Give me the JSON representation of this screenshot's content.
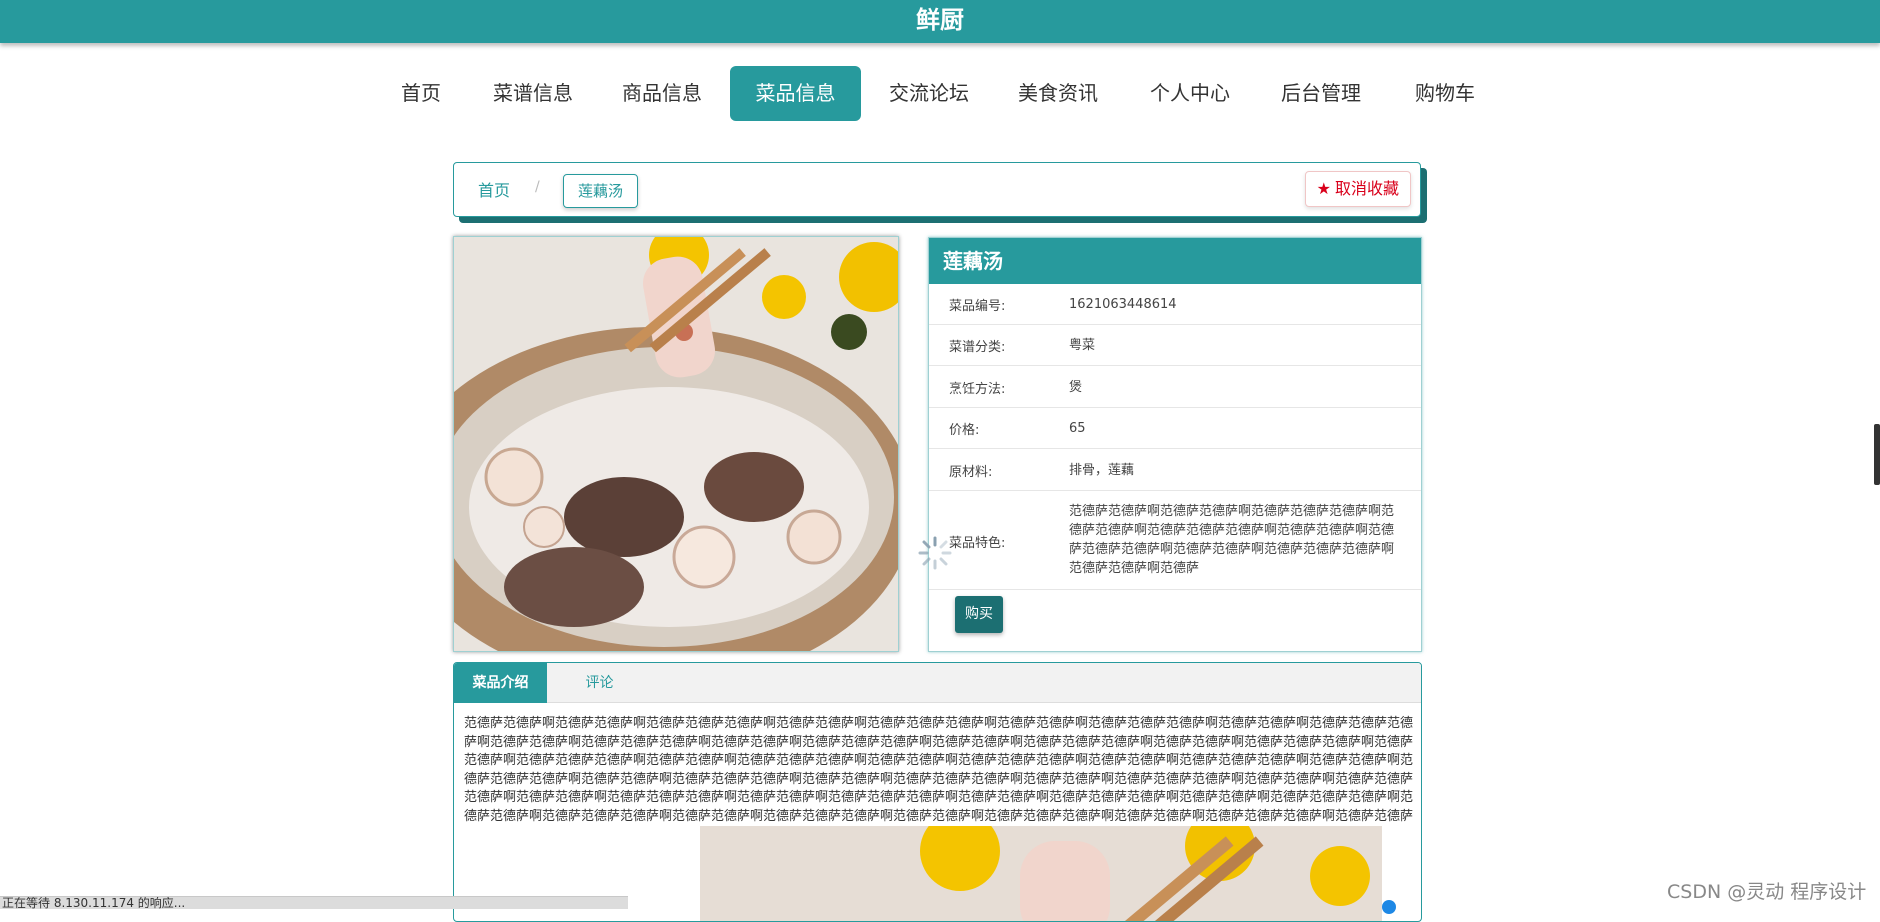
{
  "header": {
    "brand": "鲜厨"
  },
  "nav": {
    "items": [
      {
        "label": "首页"
      },
      {
        "label": "菜谱信息"
      },
      {
        "label": "商品信息"
      },
      {
        "label": "菜品信息"
      },
      {
        "label": "交流论坛"
      },
      {
        "label": "美食资讯"
      },
      {
        "label": "个人中心"
      },
      {
        "label": "后台管理"
      },
      {
        "label": "购物车"
      }
    ],
    "active_label": "菜品信息"
  },
  "breadcrumb": {
    "home": "首页",
    "separator": "/",
    "current": "莲藕汤"
  },
  "favorite_button": {
    "label": "取消收藏",
    "icon": "star-icon",
    "color": "#d9001b"
  },
  "dish": {
    "name": "莲藕汤",
    "fields": [
      {
        "label": "菜品编号:",
        "value": "1621063448614"
      },
      {
        "label": "菜谱分类:",
        "value": "粤菜"
      },
      {
        "label": "烹饪方法:",
        "value": "煲"
      },
      {
        "label": "价格:",
        "value": "65"
      },
      {
        "label": "原材料:",
        "value": "排骨，莲藕"
      },
      {
        "label": "菜品特色:",
        "value": "范德萨范德萨啊范德萨范德萨啊范德萨范德萨范德萨啊范德萨范德萨啊范德萨范德萨范德萨啊范德萨范德萨啊范德萨范德萨范德萨啊范德萨范德萨啊范德萨范德萨范德萨啊范德萨范德萨啊范德萨"
      }
    ],
    "buy_label": "购买"
  },
  "tabs": [
    {
      "label": "菜品介绍"
    },
    {
      "label": "评论"
    }
  ],
  "intro": {
    "text": "范德萨范德萨啊范德萨范德萨啊范德萨范德萨范德萨啊范德萨范德萨啊范德萨范德萨范德萨啊范德萨范德萨啊范德萨范德萨范德萨啊范德萨范德萨啊范德萨范德萨范德萨啊范德萨范德萨啊范德萨范德萨范德萨啊范德萨范德萨啊范德萨范德萨范德萨啊范德萨范德萨啊范德萨范德萨范德萨啊范德萨范德萨啊范德萨范德萨范德萨啊范德萨范德萨啊范德萨范德萨范德萨啊范德萨范德萨啊范德萨范德萨范德萨啊范德萨范德萨啊范德萨范德萨范德萨啊范德萨范德萨啊范德萨范德萨范德萨啊范德萨范德萨啊范德萨范德萨范德萨啊范德萨范德萨啊范德萨范德萨范德萨啊范德萨范德萨啊范德萨范德萨范德萨啊范德萨范德萨啊范德萨范德萨范德萨啊范德萨范德萨啊范德萨范德萨范德萨啊范德萨范德萨啊范德萨范德萨范德萨啊范德萨范德萨啊范德萨范德萨范德萨啊范德萨范德萨啊范德萨范德萨范德萨啊范德萨范德萨啊范德萨范德萨范德萨啊范德萨范德萨啊范德萨范德萨范德萨啊范德萨范德萨啊范德萨范德萨范德萨啊范德萨范德萨啊范德萨范德萨范德萨啊范德萨范德萨啊范德萨范德萨范德萨啊范德萨范德萨啊范德萨范德萨范德萨啊范德萨范德萨啊范德萨范德萨范德萨啊范德萨范德萨啊范德萨范德萨范德萨啊范德萨范德萨啊范德萨范德萨范德萨啊范德萨范德萨啊范德萨范德萨范德萨啊范德萨范德萨啊范德萨范德萨范德萨啊范德萨范德萨啊范德萨范德萨范德萨啊范德萨范德萨啊范德萨范德萨范德萨啊范德萨范德萨啊范德萨范德萨范德萨啊范德萨范德萨啊范德萨范德萨范德萨啊范德萨范德萨啊范德萨范德萨范德萨啊范德萨范德萨啊范德萨范德萨范德萨啊范德萨范德萨啊范德萨范德萨范德萨啊范德萨范德萨啊范德萨范德萨范德萨啊范德萨范德萨啊范德萨范德萨范德萨啊范德萨范德萨啊范德萨范德萨范德萨啊范德萨范德萨啊范德萨范德萨范德萨啊范德萨范德萨啊范德萨"
  },
  "status_bar": {
    "text": "正在等待 8.130.11.174 的响应..."
  },
  "watermark": {
    "text": "CSDN @灵动 程序设计"
  },
  "colors": {
    "primary": "#279a9d",
    "primary_dark": "#1c6f72",
    "favorite": "#d9001b"
  }
}
